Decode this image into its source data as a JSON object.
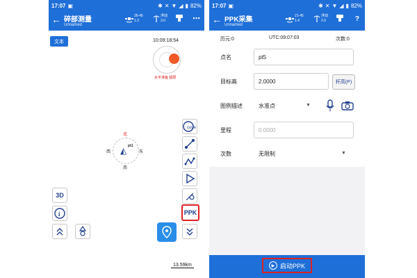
{
  "left": {
    "status": {
      "time": "17:07",
      "battery": "82%"
    },
    "appbar": {
      "title": "碎部测量",
      "subtitle": "Unnamed",
      "sats_top": "26-45",
      "sats_bottom": "1.3",
      "solution": "浮动",
      "solution_value": "3.0",
      "more": "⋯"
    },
    "map": {
      "text_button": "文本",
      "clock": "10:09:18:54",
      "compass_label": "水平准备 超限",
      "north": "北",
      "west": "西",
      "east": "东",
      "south": "南",
      "point_label": "pt1",
      "scale": "13.59km"
    },
    "tools": {
      "code_label": "code",
      "ppk_label": "PPK",
      "threed_label": "3D",
      "info_label": "i"
    }
  },
  "right": {
    "status": {
      "time": "17:07",
      "battery": "82%"
    },
    "appbar": {
      "title": "PPK采集",
      "subtitle": "Unnamed",
      "sats_top": "21-45",
      "sats_bottom": "1.4",
      "solution": "浮动",
      "solution_value": "2.0",
      "help": "?"
    },
    "info": {
      "elapsed": "历元:0",
      "utc": "UTC:09:07:03",
      "count": "次数:0"
    },
    "form": {
      "point_name_label": "点名",
      "point_name_value": "pt5",
      "target_height_label": "目标高",
      "target_height_value": "2.0000",
      "pole_button": "杆高(P)",
      "legend_label": "图例描述",
      "legend_value": "水准点",
      "mileage_label": "里程",
      "mileage_placeholder": "0.0000",
      "times_label": "次数",
      "times_value": "无限制"
    },
    "start_button": "启动PPK"
  }
}
